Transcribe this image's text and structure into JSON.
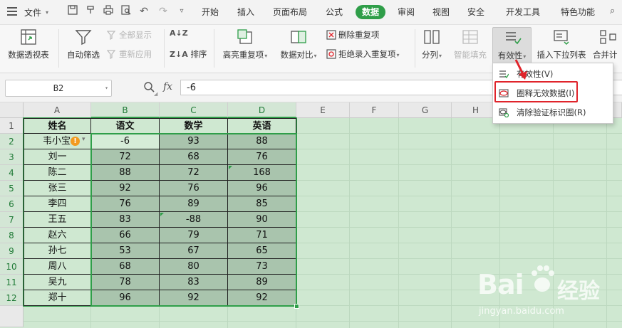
{
  "menubar": {
    "file_label": "文件",
    "tabs": [
      "开始",
      "插入",
      "页面布局",
      "公式",
      "数据",
      "审阅",
      "视图",
      "安全",
      "开发工具",
      "特色功能"
    ],
    "active_tab": "数据"
  },
  "ribbon": {
    "pivot": "数据透视表",
    "autofilter": "自动筛选",
    "show_all": "全部显示",
    "reapply": "重新应用",
    "sort": "排序",
    "highlight_dup": "高亮重复项",
    "compare": "数据对比",
    "remove_dup": "删除重复项",
    "reject_dup": "拒绝录入重复项",
    "split": "分列",
    "smart_fill": "智能填充",
    "validity": "有效性",
    "insert_dropdown": "插入下拉列表",
    "consolidate": "合并计"
  },
  "formula_bar": {
    "cell_ref": "B2",
    "fx": "fx",
    "value": "-6"
  },
  "sheet": {
    "col_headers": [
      "A",
      "B",
      "C",
      "D",
      "E",
      "F",
      "G",
      "H"
    ],
    "row_headers": [
      "1",
      "2",
      "3",
      "4",
      "5",
      "6",
      "7",
      "8",
      "9",
      "10",
      "11",
      "12"
    ],
    "header_row": [
      "姓名",
      "语文",
      "数学",
      "英语"
    ],
    "rows": [
      [
        "韦小宝",
        "-6",
        "93",
        "88"
      ],
      [
        "刘一",
        "72",
        "68",
        "76"
      ],
      [
        "陈二",
        "88",
        "72",
        "168"
      ],
      [
        "张三",
        "92",
        "76",
        "96"
      ],
      [
        "李四",
        "76",
        "89",
        "85"
      ],
      [
        "王五",
        "83",
        "-88",
        "90"
      ],
      [
        "赵六",
        "66",
        "79",
        "71"
      ],
      [
        "孙七",
        "53",
        "67",
        "65"
      ],
      [
        "周八",
        "68",
        "80",
        "73"
      ],
      [
        "吴九",
        "78",
        "83",
        "89"
      ],
      [
        "郑十",
        "96",
        "92",
        "92"
      ]
    ]
  },
  "validity_menu": {
    "items": [
      "有效性(V)",
      "圈释无效数据(I)",
      "清除验证标识圈(R)"
    ],
    "highlighted": "圈释无效数据(I)"
  },
  "watermark": {
    "brand": "Bai",
    "brand_cn": "经验",
    "url": "jingyan.baidu.com"
  },
  "colors": {
    "accent": "#2f9e49",
    "grid_bg": "#cfe8d1",
    "highlight_border": "#e0242b",
    "warning": "#f29a1f"
  }
}
